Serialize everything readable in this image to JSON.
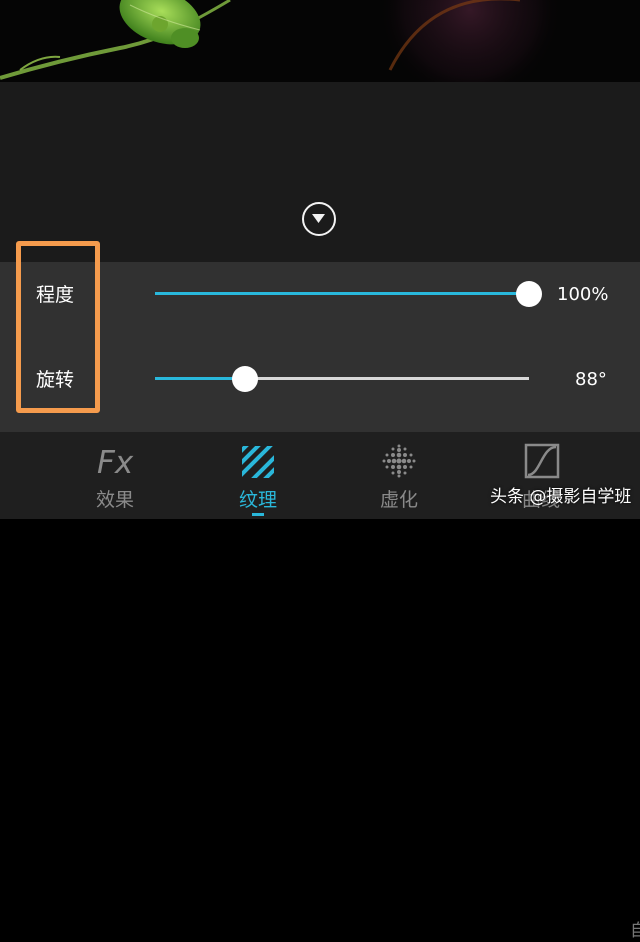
{
  "panel": {
    "rows": [
      {
        "label": "程度",
        "value_text": "100%",
        "level": 1.0
      },
      {
        "label": "旋转",
        "value_text": "88°",
        "level": 0.24
      }
    ]
  },
  "toolbar": {
    "tools": [
      {
        "label": "效果",
        "icon": "fx-icon",
        "active": false
      },
      {
        "label": "纹理",
        "icon": "texture-stripes-icon",
        "active": true
      },
      {
        "label": "虚化",
        "icon": "dot-grid-icon",
        "active": false
      },
      {
        "label": "曲线",
        "icon": "curve-icon",
        "active": false
      }
    ],
    "edge_label": "自"
  },
  "watermark": "头条 @摄影自学班",
  "colors": {
    "accent": "#2ab7da",
    "highlight": "#f59b4d",
    "panel_bg": "#313131"
  }
}
